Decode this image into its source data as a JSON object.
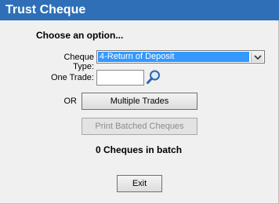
{
  "window": {
    "title": "Trust Cheque"
  },
  "form": {
    "heading": "Choose an option...",
    "cheque_type_label": "Cheque Type:",
    "cheque_type_value": "4-Return of Deposit",
    "one_trade_label": "One Trade:",
    "one_trade_value": "",
    "or_label": "OR",
    "multiple_trades_label": "Multiple Trades",
    "print_batched_label": "Print Batched Cheques",
    "batch_count_text": "0 Cheques in batch",
    "exit_label": "Exit"
  },
  "icons": {
    "dropdown": "chevron-down-icon",
    "search": "magnifier-icon"
  },
  "colors": {
    "title_bar": "#2f6fb8",
    "selection": "#3399ff",
    "disabled_text": "#8c8c8c"
  }
}
